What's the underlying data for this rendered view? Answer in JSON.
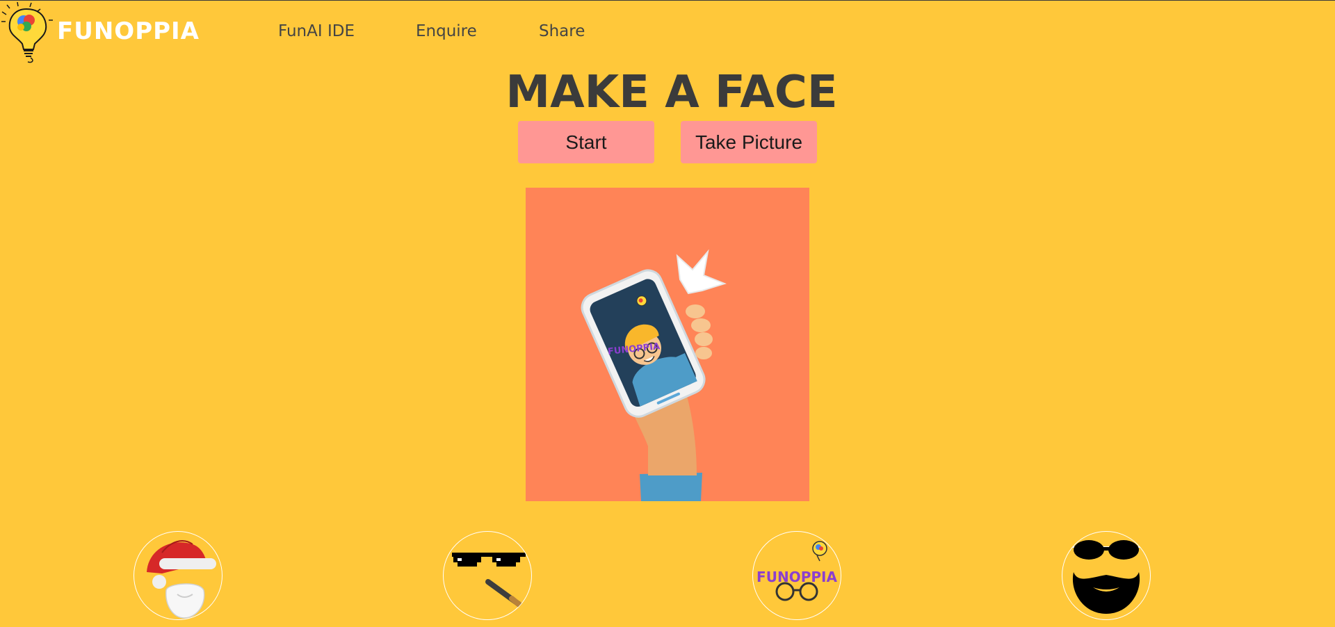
{
  "brand": {
    "name": "FUNOPPIA",
    "logo_icon": "lightbulb-brain-icon"
  },
  "nav": {
    "items": [
      {
        "label": "FunAI IDE"
      },
      {
        "label": "Enquire"
      },
      {
        "label": "Share"
      }
    ]
  },
  "main": {
    "title": "MAKE A FACE",
    "buttons": {
      "start_label": "Start",
      "take_picture_label": "Take Picture"
    },
    "preview": {
      "illustration": "hand-holding-phone-selfie-illustration",
      "phone_text": "FUNOPPIA"
    }
  },
  "filters": [
    {
      "icon": "santa-hat-beard-icon"
    },
    {
      "icon": "pixel-sunglasses-cigarette-icon"
    },
    {
      "icon": "funoppia-glasses-icon",
      "text": "FUNOPPIA"
    },
    {
      "icon": "black-glasses-beard-icon"
    }
  ],
  "colors": {
    "background": "#FFC83A",
    "button": "#FF9794",
    "preview_bg": "#FF8457",
    "title": "#3b3b3b",
    "nav_text": "#444444",
    "brand_text": "#ffffff"
  }
}
